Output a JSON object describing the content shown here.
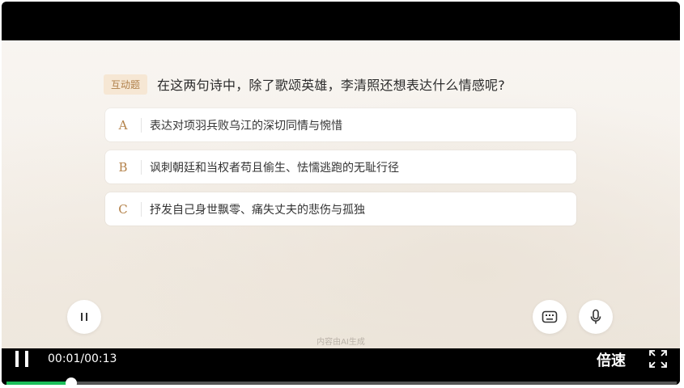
{
  "quiz": {
    "tag": "互动题",
    "question": "在这两句诗中，除了歌颂英雄，李清照还想表达什么情感呢?",
    "options": [
      {
        "letter": "A",
        "text": "表达对项羽兵败乌江的深切同情与惋惜"
      },
      {
        "letter": "B",
        "text": "讽刺朝廷和当权者苟且偷生、怯懦逃跑的无耻行径"
      },
      {
        "letter": "C",
        "text": "抒发自己身世飘零、痛失丈夫的悲伤与孤独"
      }
    ]
  },
  "overlay": {
    "pause_icon": "pause-icon",
    "keyboard_icon": "keyboard-icon",
    "mic_icon": "microphone-icon",
    "ai_note": "内容由AI生成"
  },
  "player": {
    "time": "00:01/00:13",
    "speed_label": "倍速",
    "progress_fraction": 0.097,
    "play_pause_icon": "pause-icon",
    "fullscreen_icon": "fullscreen-icon",
    "accent": "#1bbf5a"
  }
}
